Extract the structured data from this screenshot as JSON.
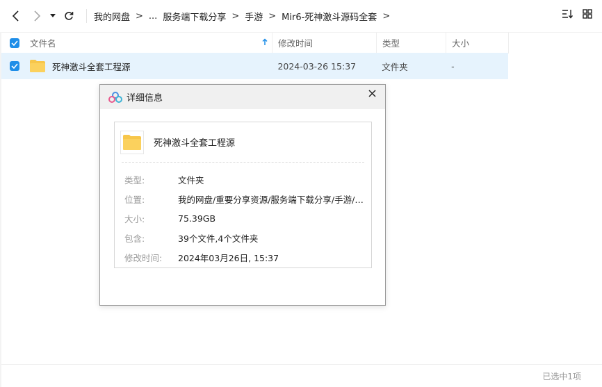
{
  "toolbar": {
    "breadcrumbs": [
      "我的网盘",
      "...",
      "服务端下载分享",
      "手游",
      "Mir6-死神激斗源码全套"
    ],
    "crumb_sep": ">"
  },
  "header": {
    "name": "文件名",
    "modified": "修改时间",
    "type": "类型",
    "size": "大小"
  },
  "rows": [
    {
      "name": "死神激斗全套工程源",
      "modified": "2024-03-26 15:37",
      "type": "文件夹",
      "size": "-"
    }
  ],
  "dialog": {
    "title": "详细信息",
    "file_name": "死神激斗全套工程源",
    "fields": [
      {
        "key": "类型:",
        "value": "文件夹"
      },
      {
        "key": "位置:",
        "value": "我的网盘/重要分享资源/服务端下载分享/手游/M..."
      },
      {
        "key": "大小:",
        "value": "75.39GB"
      },
      {
        "key": "包含:",
        "value": "39个文件,4个文件夹"
      },
      {
        "key": "修改时间:",
        "value": "2024年03月26日, 15:37"
      }
    ]
  },
  "status": {
    "text": "已选中1项"
  },
  "colors": {
    "accent": "#1f8ee8",
    "selected_row": "#e6f3fd",
    "folder": "#f7c64a"
  },
  "icons": [
    "back-arrow-icon",
    "forward-arrow-icon",
    "dropdown-caret-icon",
    "refresh-icon",
    "sort-icon",
    "grid-view-icon",
    "folder-icon",
    "close-icon",
    "cloud-logo-icon",
    "checkbox-checked-icon",
    "sort-up-arrow-icon"
  ]
}
